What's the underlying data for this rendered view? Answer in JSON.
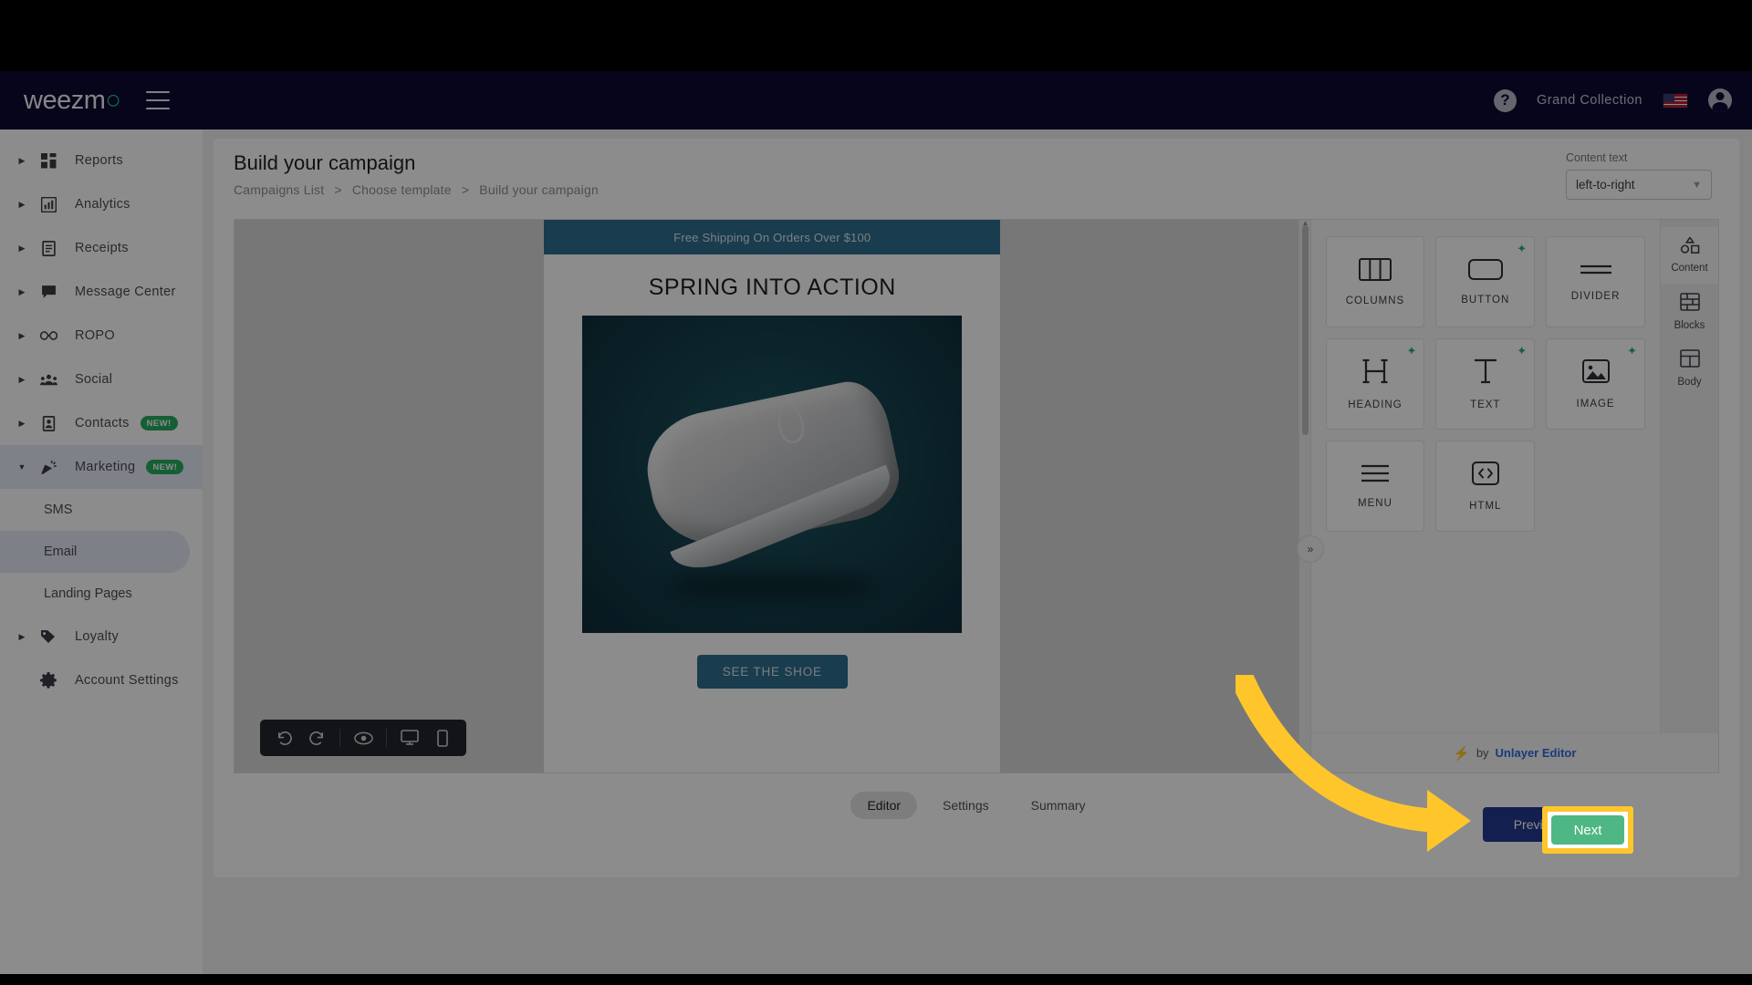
{
  "topbar": {
    "logo_text": "weezm",
    "logo_mark": "○",
    "menu_icon": "hamburger-icon",
    "help_icon": "?",
    "account_name": "Grand Collection",
    "locale_flag": "us-flag",
    "avatar_icon": "account-avatar-icon"
  },
  "sidebar": {
    "items": [
      {
        "label": "Reports",
        "icon": "grid-icon",
        "expandable": true,
        "expanded": false
      },
      {
        "label": "Analytics",
        "icon": "bar-chart-icon",
        "expandable": true,
        "expanded": false
      },
      {
        "label": "Receipts",
        "icon": "receipt-icon",
        "expandable": true,
        "expanded": false
      },
      {
        "label": "Message Center",
        "icon": "chat-bubble-icon",
        "expandable": true,
        "expanded": false
      },
      {
        "label": "ROPO",
        "icon": "infinity-icon",
        "expandable": true,
        "expanded": false
      },
      {
        "label": "Social",
        "icon": "people-icon",
        "expandable": true,
        "expanded": false
      },
      {
        "label": "Contacts",
        "icon": "contact-card-icon",
        "expandable": true,
        "expanded": false,
        "badge": "NEW!"
      },
      {
        "label": "Marketing",
        "icon": "megaphone-icon",
        "expandable": true,
        "expanded": true,
        "badge": "NEW!"
      },
      {
        "label": "Loyalty",
        "icon": "tag-icon",
        "expandable": true,
        "expanded": false
      },
      {
        "label": "Account Settings",
        "icon": "gear-icon",
        "expandable": false,
        "expanded": false
      }
    ],
    "marketing_subitems": [
      {
        "label": "SMS",
        "selected": false
      },
      {
        "label": "Email",
        "selected": true
      },
      {
        "label": "Landing Pages",
        "selected": false
      }
    ],
    "badge_color": "#27ae60",
    "selected_bg": "#e4e9f6"
  },
  "page": {
    "title": "Build your campaign",
    "breadcrumb": [
      "Campaigns List",
      "Choose template",
      "Build your campaign"
    ],
    "breadcrumb_separator": ">"
  },
  "content_text": {
    "label": "Content text",
    "value": "left-to-right",
    "chevron": "chevron-down-icon"
  },
  "editor": {
    "toolbar": [
      {
        "name": "undo-icon",
        "glyph": "↺"
      },
      {
        "name": "redo-icon",
        "glyph": "↻"
      },
      {
        "name": "preview-eye-icon",
        "glyph": "eye"
      },
      {
        "name": "desktop-view-icon",
        "glyph": "desktop"
      },
      {
        "name": "mobile-view-icon",
        "glyph": "mobile"
      }
    ],
    "collapse_icon": "»"
  },
  "email": {
    "promo_bar": "Free Shipping On Orders Over $100",
    "promo_bar_color": "#2f6e8f",
    "heading": "SPRING INTO ACTION",
    "hero_alt": "sneaker-product-image",
    "cta_label": "SEE THE SHOE",
    "cta_color": "#2f6e8f"
  },
  "tools": {
    "blocks": [
      {
        "label": "COLUMNS",
        "icon": "columns-icon",
        "ai": false
      },
      {
        "label": "BUTTON",
        "icon": "button-icon",
        "ai": true
      },
      {
        "label": "DIVIDER",
        "icon": "divider-icon",
        "ai": false
      },
      {
        "label": "HEADING",
        "icon": "heading-icon",
        "ai": true
      },
      {
        "label": "TEXT",
        "icon": "text-icon",
        "ai": true
      },
      {
        "label": "IMAGE",
        "icon": "image-icon",
        "ai": true
      },
      {
        "label": "MENU",
        "icon": "menu-icon",
        "ai": false
      },
      {
        "label": "HTML",
        "icon": "code-icon",
        "ai": false
      }
    ],
    "ai_badge_color": "#2fae6e",
    "tabs": [
      {
        "label": "Content",
        "icon": "shapes-icon",
        "active": true
      },
      {
        "label": "Blocks",
        "icon": "brick-wall-icon",
        "active": false
      },
      {
        "label": "Body",
        "icon": "layout-icon",
        "active": false
      }
    ],
    "footer": {
      "by_text": "by",
      "brand": "Unlayer Editor",
      "bolt_icon": "lightning-bolt-icon"
    }
  },
  "bottom_tabs": [
    {
      "label": "Editor",
      "active": true
    },
    {
      "label": "Settings",
      "active": false
    },
    {
      "label": "Summary",
      "active": false
    }
  ],
  "footer_actions": {
    "prev_label": "Previous",
    "next_label": "Next",
    "next_color": "#4fb783",
    "highlight_color": "#ffc62b",
    "annotation": "arrow-pointing-to-next-button"
  }
}
